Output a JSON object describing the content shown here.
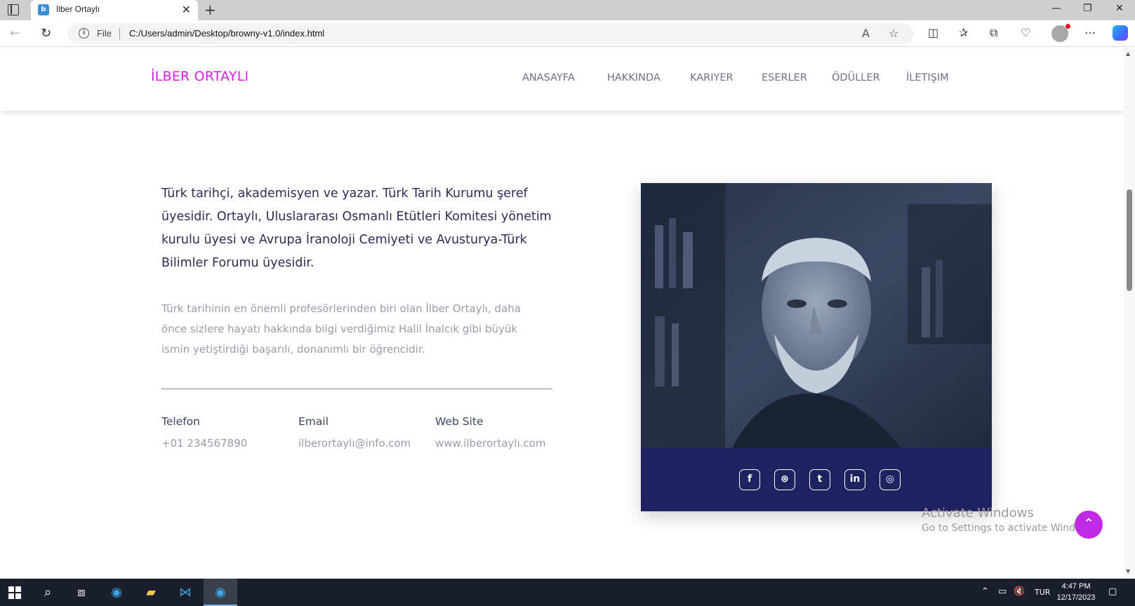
{
  "browser": {
    "tab_title": "İlber Ortaylı",
    "file_label": "File",
    "url": "C:/Users/admin/Desktop/browny-v1.0/index.html"
  },
  "site": {
    "logo": "İLBER ORTAYLI",
    "nav": [
      "ANASAYFA",
      "HAKKINDA",
      "KARIYER",
      "ESERLER",
      "ÖDÜLLER",
      "İLETIŞIM"
    ],
    "lead": "Türk tarihçi, akademisyen ve yazar. Türk Tarih Kurumu şeref üyesidir. Ortaylı, Uluslararası Osmanlı Etütleri Komitesi yönetim kurulu üyesi ve Avrupa İranoloji Cemiyeti ve Avusturya-Türk Bilimler Forumu üyesidir.",
    "description": "Türk tarihinin en önemli profesörlerinden biri olan İlber Ortaylı, daha önce sizlere hayatı hakkında bilgi verdiğimiz Halil İnalcık gibi büyük ismin yetiştirdiği başarılı, donanımlı bir öğrencidir.",
    "contacts": [
      {
        "label": "Telefon",
        "value": "+01 234567890"
      },
      {
        "label": "Email",
        "value": "ilberortaylı@info.com"
      },
      {
        "label": "Web Site",
        "value": "www.ilberortaylı.com"
      }
    ],
    "social_icons": [
      "facebook-icon",
      "dribbble-icon",
      "twitter-icon",
      "linkedin-icon",
      "instagram-icon"
    ],
    "colors": {
      "logo": "#d71fe8",
      "social_bar": "#1e2261",
      "scroll_top": "#c12be8"
    }
  },
  "watermark": {
    "line1": "Activate Windows",
    "line2": "Go to Settings to activate Windows."
  },
  "taskbar": {
    "language": "TUR",
    "time": "4:47 PM",
    "date": "12/17/2023"
  }
}
